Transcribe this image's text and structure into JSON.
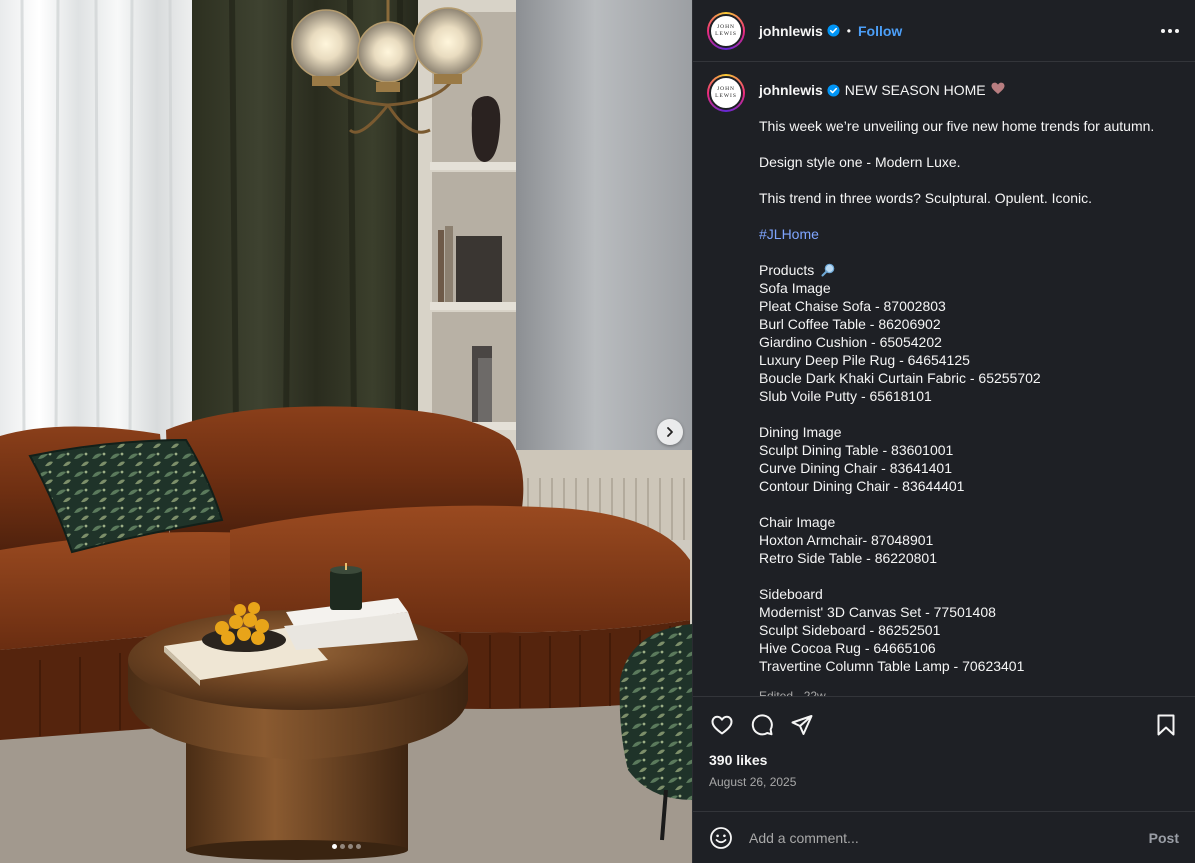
{
  "account": {
    "username": "johnlewis",
    "logo_line1": "JOHN",
    "logo_line2": "LEWIS",
    "follow_label": "Follow",
    "separator": "•"
  },
  "media": {
    "slide_count": 4,
    "active_slide": 1
  },
  "caption": {
    "title": "NEW SEASON HOME",
    "title_emoji": "heart",
    "lines": {
      "intro": "This week we’re unveiling our five new home trends for autumn.",
      "style": "Design style one - Modern Luxe.",
      "trend": "This trend in three words? Sculptural. Opulent. Iconic.",
      "hashtag": "#JLHome",
      "products_heading": "Products",
      "products_emoji": "magnifying-glass",
      "sofa": [
        "Sofa Image",
        "Pleat Chaise Sofa - 87002803",
        "Burl Coffee Table - 86206902",
        "Giardino Cushion - 65054202",
        "Luxury Deep Pile Rug - 64654125",
        "Boucle Dark Khaki Curtain Fabric - 65255702",
        "Slub Voile Putty - 65618101"
      ],
      "dining": [
        "Dining Image",
        "Sculpt Dining Table - 83601001",
        "Curve Dining Chair - 83641401",
        "Contour Dining Chair - 83644401"
      ],
      "chair": [
        "Chair Image",
        "Hoxton Armchair- 87048901",
        "Retro Side Table - 86220801"
      ],
      "sideboard": [
        "Sideboard",
        "Modernist' 3D Canvas Set - 77501408",
        "Sculpt Sideboard - 86252501",
        "Hive Cocoa Rug - 64665106",
        "Travertine Column Table Lamp - 70623401"
      ]
    },
    "meta": "Edited · 22w"
  },
  "stats": {
    "likes": "390 likes",
    "date": "August 26, 2025"
  },
  "comment_box": {
    "placeholder": "Add a comment...",
    "post_label": "Post"
  },
  "colors": {
    "panel_bg": "#1e2025",
    "link_blue": "#4c9ff8",
    "hashtag": "#7fa5ff",
    "muted": "#a8a8a8"
  }
}
